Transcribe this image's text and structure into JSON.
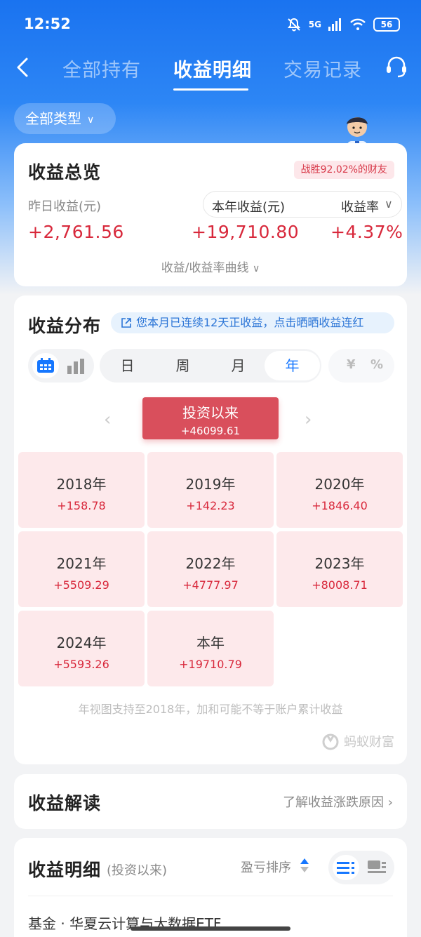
{
  "status_bar": {
    "time": "12:52",
    "signal": "5G",
    "battery": "56"
  },
  "nav": {
    "tabs": [
      {
        "label": "全部持有",
        "active": false
      },
      {
        "label": "收益明细",
        "active": true
      },
      {
        "label": "交易记录",
        "active": false
      }
    ]
  },
  "filter": {
    "type_label": "全部类型"
  },
  "overview": {
    "title": "收益总览",
    "beat_badge": "战胜92.02%的财友",
    "yesterday_label": "昨日收益(元)",
    "yesterday_value": "+2,761.56",
    "year_label": "本年收益(元)",
    "year_value": "+19,710.80",
    "rate_label": "收益率",
    "rate_value": "+4.37%",
    "curve_link": "收益/收益率曲线"
  },
  "distribution": {
    "title": "收益分布",
    "streak_text": "您本月已连续12天正收益，点击晒晒收益连红",
    "periods": [
      {
        "label": "日",
        "selected": false
      },
      {
        "label": "周",
        "selected": false
      },
      {
        "label": "月",
        "selected": false
      },
      {
        "label": "年",
        "selected": true
      }
    ],
    "units": [
      "¥",
      "%"
    ],
    "since": {
      "label": "投资以来",
      "value": "+46099.61"
    },
    "years": [
      {
        "year": "2018年",
        "value": "+158.78"
      },
      {
        "year": "2019年",
        "value": "+142.23"
      },
      {
        "year": "2020年",
        "value": "+1846.40"
      },
      {
        "year": "2021年",
        "value": "+5509.29"
      },
      {
        "year": "2022年",
        "value": "+4777.97"
      },
      {
        "year": "2023年",
        "value": "+8008.71"
      },
      {
        "year": "2024年",
        "value": "+5593.26"
      },
      {
        "year": "本年",
        "value": "+19710.79"
      }
    ],
    "footnote": "年视图支持至2018年，加和可能不等于账户累计收益",
    "brand": "蚂蚁财富"
  },
  "interpretation": {
    "title": "收益解读",
    "link": "了解收益涨跌原因"
  },
  "details": {
    "title": "收益明细",
    "subtitle": "(投资以来)",
    "sort_label": "盈亏排序",
    "partial_row": "基金 · 华夏云计算与大数据ETF"
  },
  "colors": {
    "primary": "#1677ff",
    "gain": "#d8283b",
    "since_button": "#d94f5c",
    "year_cell_bg": "#fde9eb"
  }
}
